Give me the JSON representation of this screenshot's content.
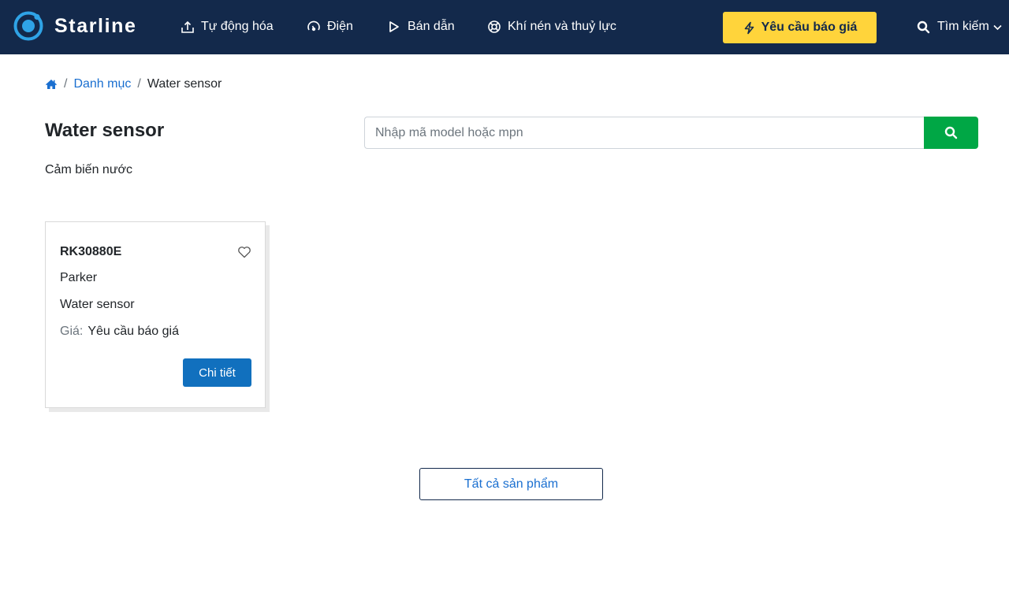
{
  "header": {
    "brand": "Starline",
    "nav": [
      {
        "label": "Tự động hóa",
        "icon": "automation-icon"
      },
      {
        "label": "Điện",
        "icon": "electric-gauge-icon"
      },
      {
        "label": "Bán dẫn",
        "icon": "play-icon"
      },
      {
        "label": "Khí nén và thuỷ lực",
        "icon": "lifebuoy-icon"
      }
    ],
    "quote_button": "Yêu cầu báo giá",
    "search_label": "Tìm kiếm"
  },
  "breadcrumb": {
    "home_icon": "home-icon",
    "items": [
      "Danh mục",
      "Water sensor"
    ],
    "separator": "/"
  },
  "page": {
    "title": "Water sensor",
    "subtitle": "Cảm biến nước"
  },
  "search": {
    "placeholder": "Nhập mã model hoặc mpn",
    "value": ""
  },
  "products": [
    {
      "model": "RK30880E",
      "brand": "Parker",
      "description": "Water sensor",
      "price_label": "Giá:",
      "price_value": "Yêu cầu báo giá",
      "detail_button": "Chi tiết"
    }
  ],
  "all_products_button": "Tất cả sản phẩm",
  "colors": {
    "header_bg": "#13294b",
    "accent_yellow": "#ffd43b",
    "search_green": "#00a745",
    "link_blue": "#1a6fd0",
    "detail_blue": "#1170be"
  }
}
